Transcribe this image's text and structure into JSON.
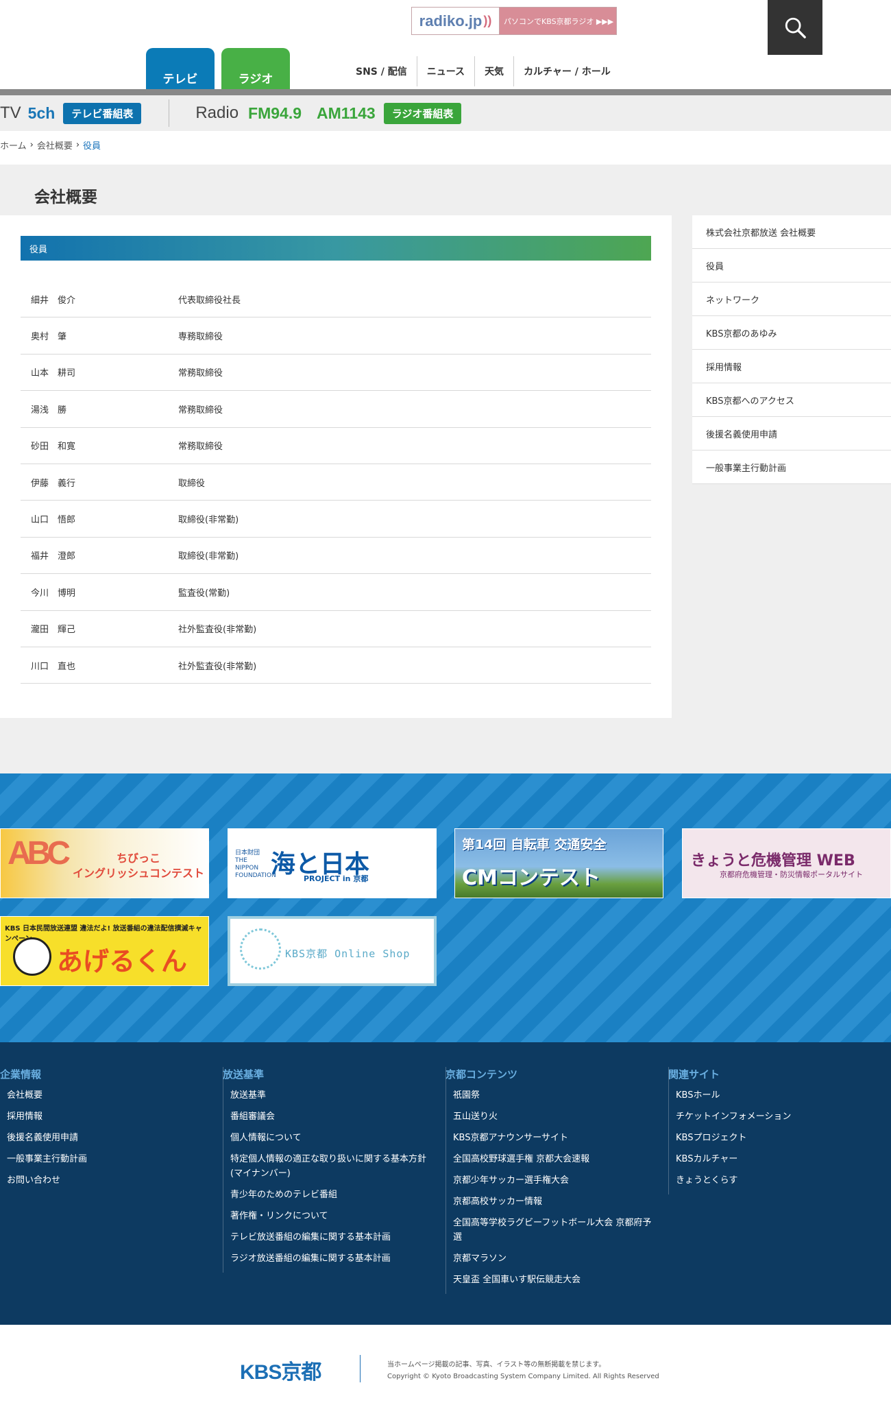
{
  "header": {
    "radiko_logo": "radiko.jp",
    "radiko_text": "パソコンでKBS京都ラジオ ▶▶▶",
    "tabs": [
      "テレビ",
      "ラジオ"
    ],
    "nav": [
      "SNS / 配信",
      "ニュース",
      "天気",
      "カルチャー / ホール"
    ]
  },
  "channel": {
    "tv_label": "TV",
    "tv_channel": "5ch",
    "tv_schedule": "テレビ番組表",
    "radio_label": "Radio",
    "fm": "FM94.9",
    "am": "AM1143",
    "radio_schedule": "ラジオ番組表"
  },
  "breadcrumb": [
    "ホーム",
    "会社概要",
    "役員"
  ],
  "page_title": "会社概要",
  "section_title": "役員",
  "officers": [
    {
      "name": "細井　俊介",
      "role": "代表取締役社長"
    },
    {
      "name": "奥村　肇",
      "role": "専務取締役"
    },
    {
      "name": "山本　耕司",
      "role": "常務取締役"
    },
    {
      "name": "湯浅　勝",
      "role": "常務取締役"
    },
    {
      "name": "砂田　和寛",
      "role": "常務取締役"
    },
    {
      "name": "伊藤　義行",
      "role": "取締役"
    },
    {
      "name": "山口　悟郎",
      "role": "取締役(非常勤)"
    },
    {
      "name": "福井　澄郎",
      "role": "取締役(非常勤)"
    },
    {
      "name": "今川　博明",
      "role": "監査役(常勤)"
    },
    {
      "name": "瀧田　輝己",
      "role": "社外監査役(非常勤)"
    },
    {
      "name": "川口　直也",
      "role": "社外監査役(非常勤)"
    }
  ],
  "sidebar": [
    "株式会社京都放送 会社概要",
    "役員",
    "ネットワーク",
    "KBS京都のあゆみ",
    "採用情報",
    "KBS京都へのアクセス",
    "後援名義使用申請",
    "一般事業主行動計画"
  ],
  "banners": {
    "english": "ちびっこ\nイングリッシュコンテスト",
    "umi_small": "日本財団 THE NIPPON FOUNDATION",
    "umi_big": "海と日本",
    "umi_project": "PROJECT in 京都",
    "bicycle_title": "第14回 自転車 交通安全",
    "bicycle_cm": "CMコンテスト",
    "kikikanri_title": "きょうと危機管理 WEB",
    "kikikanri_sub": "京都府危機管理・防災情報ポータルサイト",
    "ageru_logo": "KBS 日本民間放送連盟 違法だよ! 放送番組の違法配信撲滅キャンペーン",
    "ageru_big": "あげるくん",
    "shop": "KBS京都 Online Shop"
  },
  "footer": {
    "columns": [
      {
        "title": "企業情報",
        "items": [
          "会社概要",
          "採用情報",
          "後援名義使用申請",
          "一般事業主行動計画",
          "お問い合わせ"
        ]
      },
      {
        "title": "放送基準",
        "items": [
          "放送基準",
          "番組審議会",
          "個人情報について",
          "特定個人情報の適正な取り扱いに関する基本方針(マイナンバー)",
          "青少年のためのテレビ番組",
          "著作権・リンクについて",
          "テレビ放送番組の編集に関する基本計画",
          "ラジオ放送番組の編集に関する基本計画"
        ]
      },
      {
        "title": "京都コンテンツ",
        "items": [
          "祇園祭",
          "五山送り火",
          "KBS京都アナウンサーサイト",
          "全国高校野球選手権 京都大会速報",
          "京都少年サッカー選手権大会",
          "京都高校サッカー情報",
          "全国高等学校ラグビーフットボール大会 京都府予選",
          "京都マラソン",
          "天皇盃 全国車いす駅伝競走大会"
        ]
      },
      {
        "title": "関連サイト",
        "items": [
          "KBSホール",
          "チケットインフォメーション",
          "KBSプロジェクト",
          "KBSカルチャー",
          "きょうとくらす"
        ]
      }
    ],
    "logo": "KBS京都",
    "notice": "当ホームページ掲載の記事、写真、イラスト等の無断掲載を禁じます。",
    "copyright": "Copyright © Kyoto Broadcasting System Company Limited. All Rights Reserved"
  }
}
